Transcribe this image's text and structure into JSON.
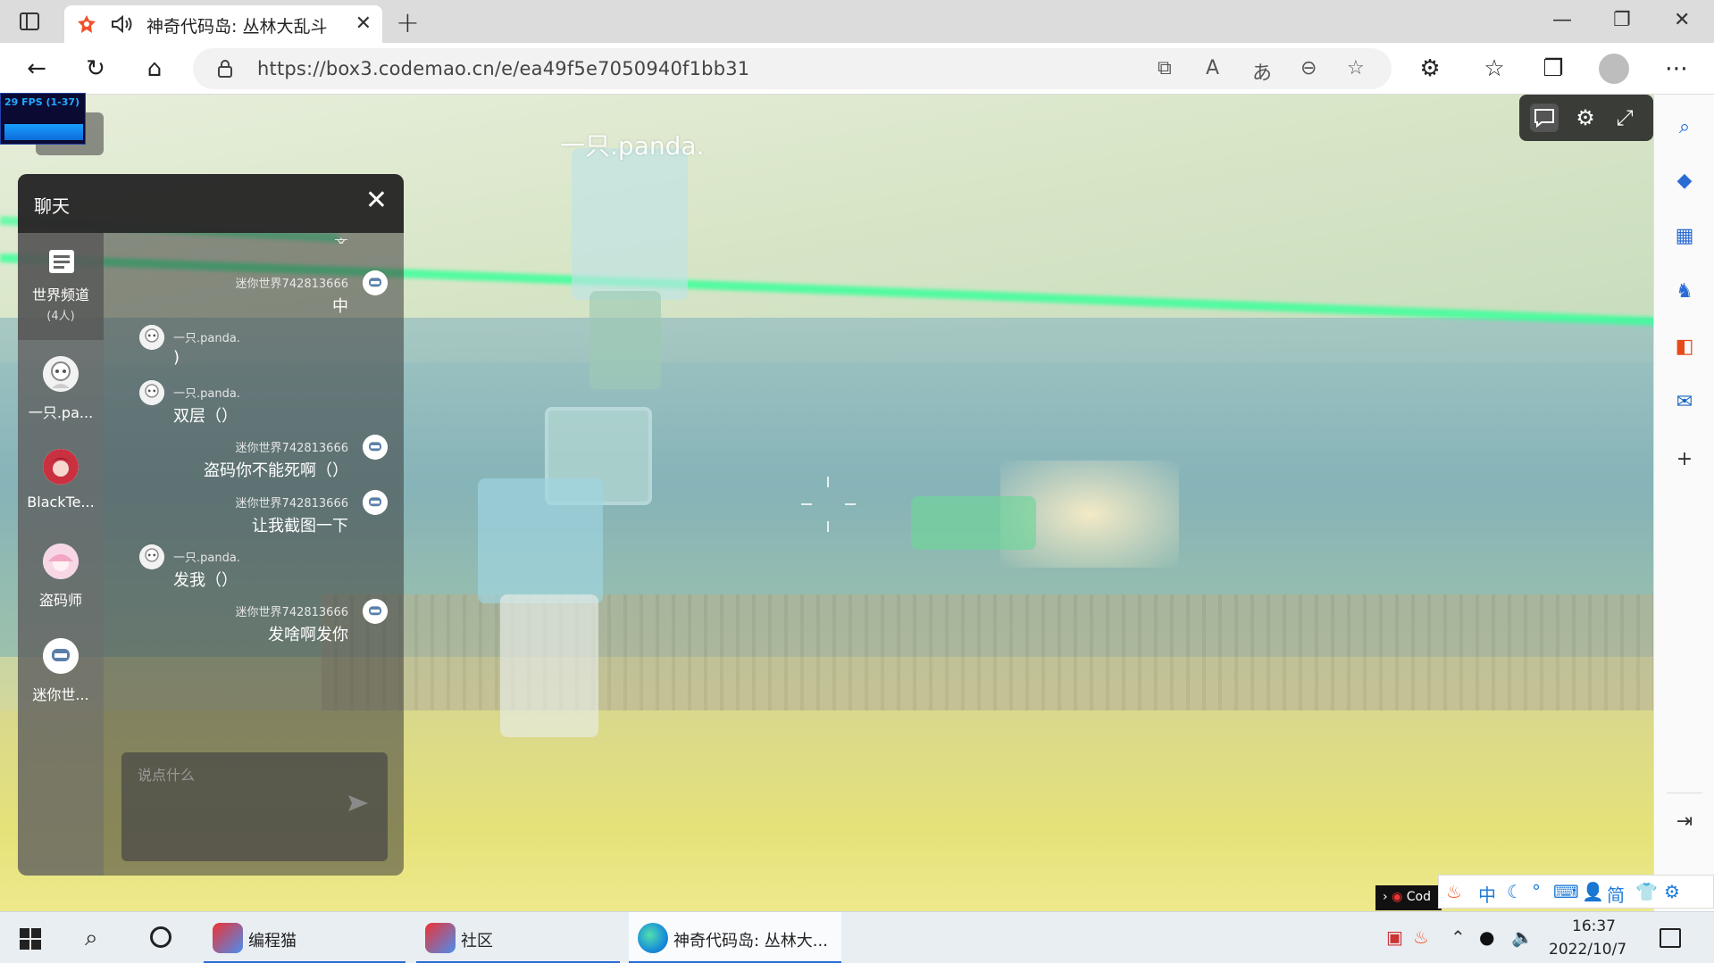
{
  "browser": {
    "tab_title": "神奇代码岛: 丛林大乱斗",
    "new_tab_label": "+",
    "url": "https://box3.codemao.cn/e/ea49f5e7050940f1bb31",
    "window_buttons": [
      "—",
      "❐",
      "✕"
    ]
  },
  "game": {
    "player_name": "一只.panda.",
    "fps_text": "29 FPS (1-37)"
  },
  "chat": {
    "title": "聊天",
    "world_channel": {
      "label": "世界频道",
      "count": "(4人)"
    },
    "users": [
      {
        "name": "一只.pa...",
        "avatar": "panda-avatar-icon"
      },
      {
        "name": "BlackTe...",
        "avatar": "red-hair-avatar-icon"
      },
      {
        "name": "盗码师",
        "avatar": "pink-avatar-icon"
      },
      {
        "name": "迷你世...",
        "avatar": "mini-avatar-icon"
      }
    ],
    "partial_top_text": "齐",
    "messages": [
      {
        "side": "right",
        "sender": "迷你世界742813666",
        "text": "中"
      },
      {
        "side": "left",
        "sender": "一只.panda.",
        "text": ")"
      },
      {
        "side": "left",
        "sender": "一只.panda.",
        "text": "双层（）"
      },
      {
        "side": "right",
        "sender": "迷你世界742813666",
        "text": "盗码你不能死啊（）"
      },
      {
        "side": "right",
        "sender": "迷你世界742813666",
        "text": "让我截图一下"
      },
      {
        "side": "left",
        "sender": "一只.panda.",
        "text": "发我（）"
      },
      {
        "side": "right",
        "sender": "迷你世界742813666",
        "text": "发啥啊发你"
      }
    ],
    "input_placeholder": "说点什么"
  },
  "ime": {
    "tip": "Cod",
    "items": [
      "中",
      "简"
    ]
  },
  "taskbar": {
    "apps": [
      {
        "label": "编程猫",
        "active": false
      },
      {
        "label": "社区",
        "active": false
      },
      {
        "label": "神奇代码岛: 丛林大...",
        "active": true
      }
    ],
    "time": "16:37",
    "date": "2022/10/7"
  },
  "colors": {
    "neon": "#3dff9a",
    "taskbar_accent": "#2b6cd4",
    "fps_graph": "#18a0ff"
  }
}
